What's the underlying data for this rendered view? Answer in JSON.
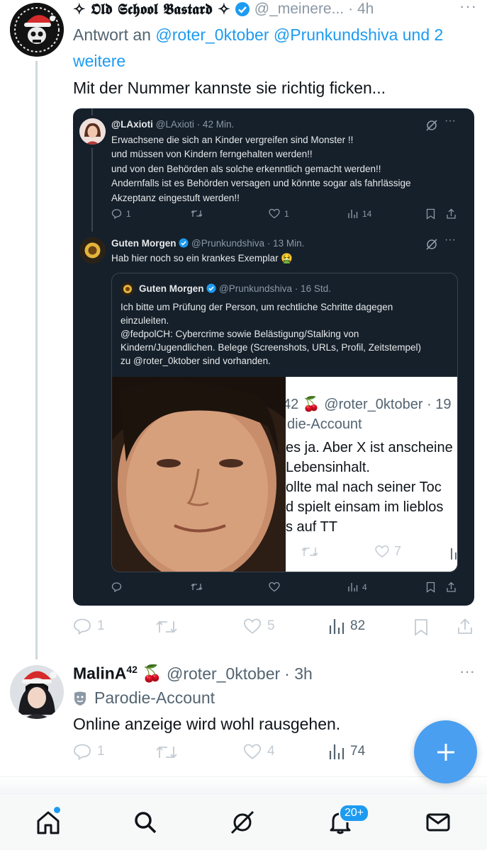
{
  "tweet1": {
    "display_name": "✧ 𝕺𝖑𝖉 𝕾𝖈𝖍𝖔𝖔𝖑 𝕭𝖆𝖘𝖙𝖆𝖗𝖉 ✧",
    "handle": "@_meinere...",
    "time": "· 4h",
    "reply_prefix": "Antwort an",
    "reply_users": "@roter_0ktober @Prunkundshiva und 2 weitere",
    "text": "Mit der Nummer kannste sie richtig ficken...",
    "stats": {
      "replies": "1",
      "likes": "5",
      "views": "82"
    }
  },
  "screenshot": {
    "post1": {
      "name": "@LAxioti",
      "handle": "@LAxioti",
      "time": "· 42 Min.",
      "text": "Erwachsene die sich an Kinder vergreifen sind Monster !!\nund müssen von Kindern ferngehalten werden!!\nund von den Behörden als solche erkenntlich gemacht werden!!\nAndernfalls ist es Behörden versagen und könnte sogar als fahrlässige\nAkzeptanz eingestuft werden!!",
      "replies": "1",
      "likes": "1",
      "views": "14"
    },
    "post2": {
      "name": "Guten Morgen",
      "handle": "@Prunkundshiva",
      "time": "· 13 Min.",
      "text": "Hab hier noch so ein krankes Exemplar 🤮",
      "views": "4"
    },
    "quote": {
      "name": "Guten Morgen",
      "handle": "@Prunkundshiva",
      "time": "· 16 Std.",
      "text": "Ich bitte um Prüfung der Person, um rechtliche Schritte dagegen\neinzuleiten.\n@fedpolCH: Cybercrime sowie Belästigung/Stalking von\nKindern/Jugendlichen. Belege (Screenshots, URLs, Profil, Zeitstempel)\nzu @roter_0ktober sind vorhanden.",
      "inner_header": "42 🍒 @roter_0ktober · 19",
      "inner_sub": "die-Account",
      "inner_lines": [
        "es ja. Aber X ist anscheine",
        "Lebensinhalt.",
        "ollte mal nach seiner Toc",
        "d spielt einsam im lieblos",
        "s auf TT"
      ],
      "inner_likes": "7"
    }
  },
  "tweet2": {
    "display_name": "MalinA",
    "name_sup": "42",
    "name_emoji": "🍒",
    "handle": "@roter_0ktober",
    "time": "· 3h",
    "label": "Parodie-Account",
    "text": "Online anzeige wird wohl rausgehen.",
    "stats": {
      "replies": "1",
      "likes": "4",
      "views": "74"
    }
  },
  "nav": {
    "notifications_badge": "20+"
  },
  "colors": {
    "accent": "#1d9bf0",
    "dark_card": "#15202b",
    "fab": "#4a9ff0"
  }
}
